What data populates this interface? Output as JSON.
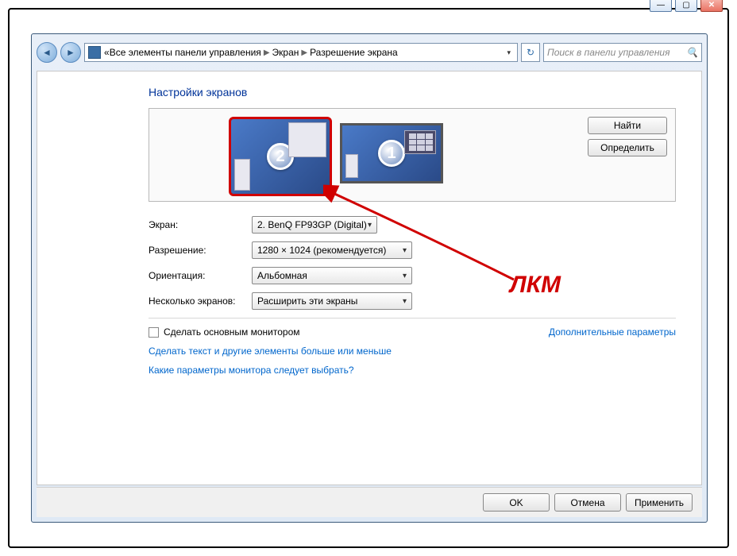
{
  "titlebar": {
    "minimize": "—",
    "maximize": "▢",
    "close": "✕"
  },
  "nav": {
    "back": "◄",
    "forward": "►",
    "breadcrumb_prefix": "«",
    "crumb1": "Все элементы панели управления",
    "crumb2": "Экран",
    "crumb3": "Разрешение экрана",
    "refresh": "↻",
    "search_placeholder": "Поиск в панели управления"
  },
  "page": {
    "title": "Настройки экранов",
    "find_btn": "Найти",
    "identify_btn": "Определить",
    "monitor1_num": "1",
    "monitor2_num": "2"
  },
  "form": {
    "screen_label": "Экран:",
    "screen_value": "2. BenQ FP93GP (Digital)",
    "resolution_label": "Разрешение:",
    "resolution_value": "1280 × 1024 (рекомендуется)",
    "orientation_label": "Ориентация:",
    "orientation_value": "Альбомная",
    "multi_label": "Несколько экранов:",
    "multi_value": "Расширить эти экраны"
  },
  "options": {
    "make_primary": "Сделать основным монитором",
    "advanced_link": "Дополнительные параметры",
    "link1": "Сделать текст и другие элементы больше или меньше",
    "link2": "Какие параметры монитора следует выбрать?"
  },
  "buttons": {
    "ok": "OK",
    "cancel": "Отмена",
    "apply": "Применить"
  },
  "annotation": {
    "label": "ЛКМ"
  }
}
